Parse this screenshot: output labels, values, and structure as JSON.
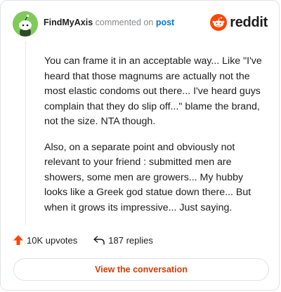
{
  "header": {
    "author": "FindMyAxis",
    "action_text": "commented on",
    "target_link": "post"
  },
  "brand": {
    "name": "reddit",
    "icon": "reddit-snoo-icon",
    "color": "#ff4500"
  },
  "comment": {
    "paragraphs": [
      "You can frame it in an acceptable way... Like \"I've heard that those magnums are actually not the most elastic condoms out there... I've heard guys complain that they do slip off...\" blame the brand, not the size. NTA though.",
      "Also, on a separate point and obviously not relevant to your friend : submitted men are showers, some men are growers... My hubby looks like a Greek god statue down there... But when it grows its impressive... Just saying."
    ]
  },
  "footer": {
    "upvotes_label": "10K upvotes",
    "upvote_icon": "upvote-arrow-icon",
    "upvote_color": "#ff4500",
    "replies_label": "187 replies",
    "reply_icon": "reply-arrow-icon"
  },
  "cta": {
    "label": "View the conversation",
    "color": "#d93a00"
  }
}
